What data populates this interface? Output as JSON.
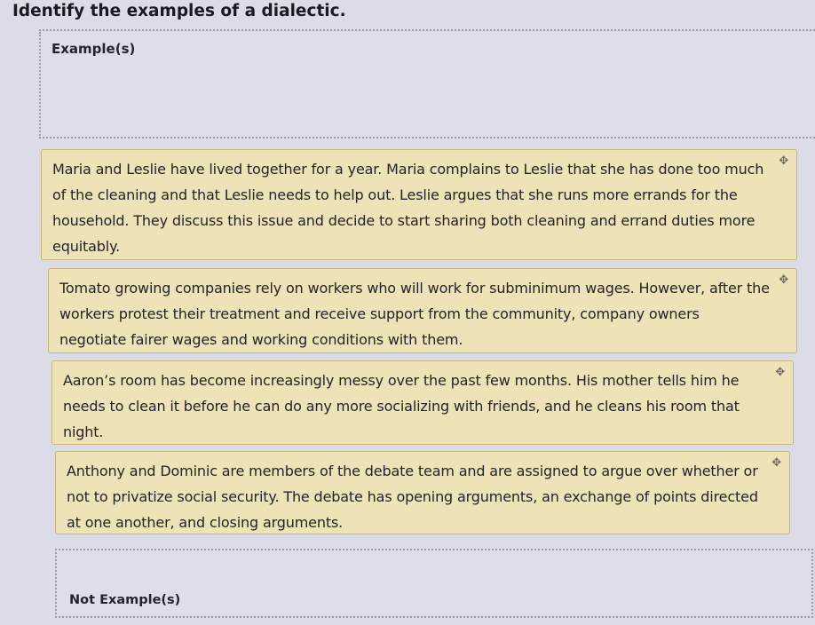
{
  "question": "Identify the examples of a dialectic.",
  "zones": {
    "example_label": "Example(s)",
    "nonexample_label": "Not Example(s)"
  },
  "drag_handle_icon": "drag-handle-icon",
  "cards": [
    {
      "text": "Maria and Leslie have lived together for a year. Maria complains to Leslie that she has done too much of the cleaning and that Leslie needs to help out. Leslie argues that she runs more errands for the household. They discuss this issue and decide to start sharing both cleaning and errand duties more equitably."
    },
    {
      "text": "Tomato growing companies rely on workers who will work for subminimum wages. However, after the workers protest their treatment and receive support from the community, company owners negotiate fairer wages and working conditions with them."
    },
    {
      "text": "Aaron’s room has become increasingly messy over the past few months. His mother tells him he needs to clean it before he can do any more socializing with friends, and he cleans his room that night."
    },
    {
      "text": "Anthony and Dominic are members of the debate team and are assigned to argue over whether or not to privatize social security. The debate has opening arguments, an exchange of points directed at one another, and closing arguments."
    }
  ]
}
